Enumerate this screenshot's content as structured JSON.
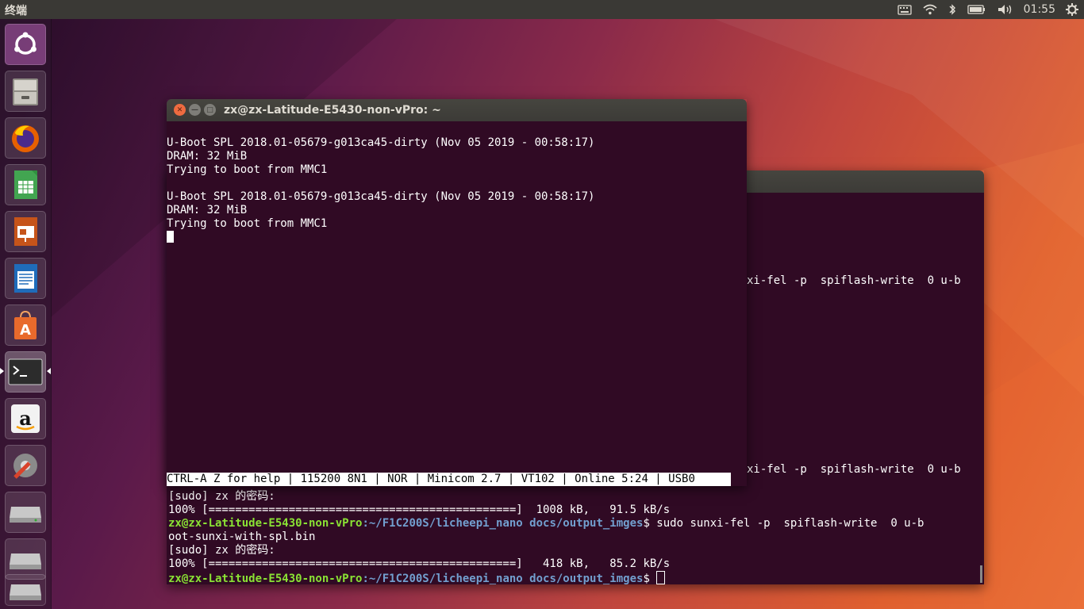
{
  "top_panel": {
    "app_title": "终端",
    "clock": "01:55"
  },
  "launcher": {
    "items": [
      "ubuntu-dash",
      "files",
      "firefox",
      "libreoffice-calc",
      "libreoffice-impress",
      "libreoffice-writer",
      "ubuntu-software",
      "terminal",
      "amazon",
      "system-settings",
      "drive-1",
      "drive-2",
      "drive-3"
    ]
  },
  "front_window": {
    "title": "zx@zx-Latitude-E5430-non-vPro: ~",
    "lines": [
      "",
      "U-Boot SPL 2018.01-05679-g013ca45-dirty (Nov 05 2019 - 00:58:17)",
      "DRAM: 32 MiB",
      "Trying to boot from MMC1",
      "",
      "U-Boot SPL 2018.01-05679-g013ca45-dirty (Nov 05 2019 - 00:58:17)",
      "DRAM: 32 MiB",
      "Trying to boot from MMC1"
    ],
    "status_bar": "CTRL-A Z for help | 115200 8N1 | NOR | Minicom 2.7 | VT102 | Online 5:24 | USB0"
  },
  "back_window": {
    "partial_line_1": "xi-fel -p  spiflash-write  0 u-b",
    "partial_line_2": "xi-fel -p  spiflash-write  0 u-b",
    "partial_line_3": "oot-sunxi-with-spl.bin",
    "sudo_prompt_1": "[sudo] zx 的密码:",
    "progress_1": "100% [==============================================]  1008 kB,   91.5 kB/s",
    "prompt_user": "zx@zx-Latitude-E5430-non-vPro",
    "prompt_path": ":~/F1C200S/licheepi_nano docs/output_imges",
    "command_1": "$ sudo sunxi-fel -p  spiflash-write  0 u-b",
    "continuation_1": "oot-sunxi-with-spl.bin",
    "sudo_prompt_2": "[sudo] zx 的密码:",
    "progress_2": "100% [==============================================]   418 kB,   85.2 kB/s",
    "prompt_user_2": "zx@zx-Latitude-E5430-non-vPro",
    "prompt_path_2": ":~/F1C200S/licheepi_nano docs/output_imges",
    "prompt_end": "$ "
  }
}
